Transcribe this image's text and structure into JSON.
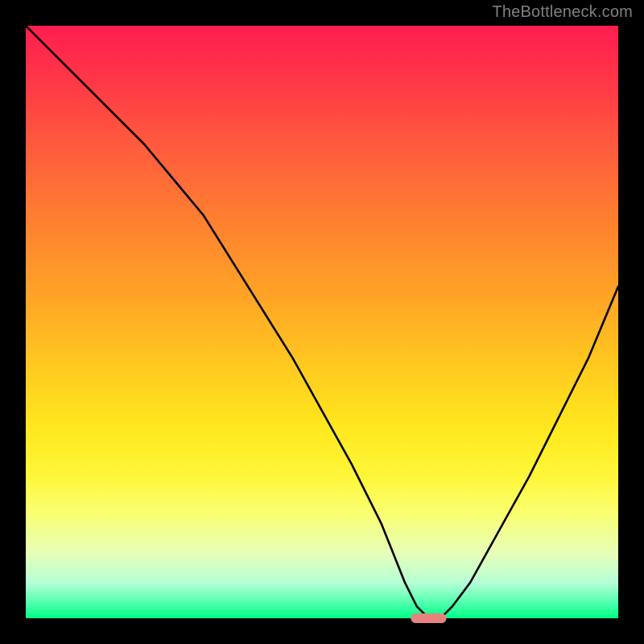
{
  "watermark": "TheBottleneck.com",
  "chart_data": {
    "type": "line",
    "title": "",
    "xlabel": "",
    "ylabel": "",
    "xlim": [
      0,
      100
    ],
    "ylim": [
      0,
      100
    ],
    "grid": false,
    "legend": false,
    "series": [
      {
        "name": "bottleneck-curve",
        "x": [
          0,
          5,
          10,
          15,
          20,
          25,
          30,
          35,
          40,
          45,
          50,
          55,
          60,
          62,
          64,
          66,
          67,
          68,
          70,
          72,
          75,
          80,
          85,
          90,
          95,
          100
        ],
        "y": [
          100,
          95,
          90,
          85,
          80,
          74,
          68,
          60,
          52,
          44,
          35,
          26,
          16,
          11,
          6,
          2,
          1,
          0,
          0,
          2,
          6,
          15,
          24,
          34,
          44,
          56
        ]
      }
    ],
    "marker": {
      "name": "optimal-marker",
      "x": 68,
      "y": 0,
      "width_pct": 6,
      "color": "#e5847e"
    }
  }
}
